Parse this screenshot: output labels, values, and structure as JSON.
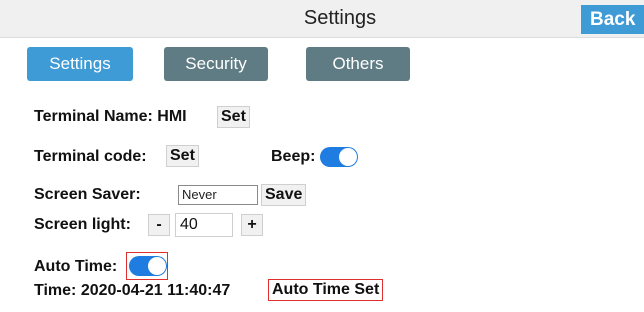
{
  "header": {
    "title": "Settings",
    "back_label": "Back"
  },
  "tabs": [
    {
      "label": "Settings",
      "active": true
    },
    {
      "label": "Security",
      "active": false
    },
    {
      "label": "Others",
      "active": false
    }
  ],
  "terminal_name": {
    "label": "Terminal Name: HMI",
    "button": "Set"
  },
  "terminal_code": {
    "label": "Terminal code:",
    "button": "Set"
  },
  "beep": {
    "label": "Beep:",
    "on": true
  },
  "screen_saver": {
    "label": "Screen Saver:",
    "value": "Never",
    "button": "Save"
  },
  "screen_light": {
    "label": "Screen light:",
    "minus": "-",
    "value": "40",
    "plus": "+"
  },
  "auto_time": {
    "label": "Auto Time:",
    "on": true
  },
  "time": {
    "label": "Time: 2020-04-21 11:40:47",
    "button": "Auto Time Set"
  },
  "colors": {
    "accent": "#3e9bd6",
    "tab_inactive": "#5f7c84",
    "toggle_on": "#1f7ce0",
    "highlight": "#e0302e"
  }
}
